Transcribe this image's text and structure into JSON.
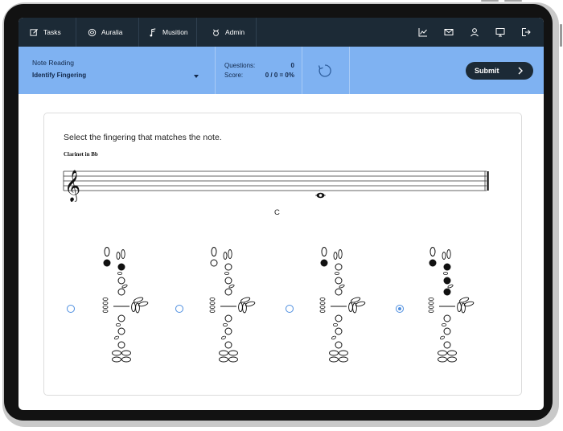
{
  "nav": {
    "tabs": [
      {
        "label": "Tasks",
        "icon": "edit-icon"
      },
      {
        "label": "Auralia",
        "icon": "auralia-logo-icon"
      },
      {
        "label": "Musition",
        "icon": "musition-logo-icon"
      },
      {
        "label": "Admin",
        "icon": "admin-icon"
      }
    ],
    "right_icons": [
      "chart-icon",
      "mail-icon",
      "user-icon",
      "monitor-icon",
      "logout-icon"
    ]
  },
  "toolbar": {
    "title": "Note Reading",
    "topic": "Identify Fingering",
    "questions_label": "Questions:",
    "questions_value": "0",
    "score_label": "Score:",
    "score_value": "0 / 0 = 0%",
    "submit_label": "Submit"
  },
  "question": {
    "prompt": "Select the fingering that matches the note.",
    "instrument": "Clarinet in Bb",
    "clef": "treble",
    "note": "C",
    "options": [
      {
        "selected": false,
        "filled": [
          0,
          1
        ]
      },
      {
        "selected": false,
        "filled": []
      },
      {
        "selected": false,
        "filled": [
          0
        ]
      },
      {
        "selected": true,
        "filled": [
          0,
          1,
          4,
          5
        ]
      }
    ]
  },
  "colors": {
    "nav_bg": "#1c2a36",
    "toolbar_bg": "#7fb2f2",
    "accent": "#4f8fe0"
  }
}
